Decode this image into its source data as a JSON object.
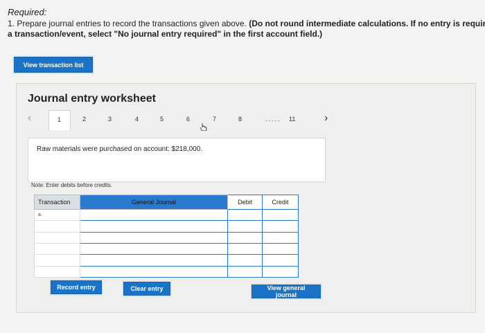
{
  "required": {
    "title": "Required:",
    "line1_normal": "1. Prepare journal entries to record the transactions given above.",
    "line1_bold": "(Do not round intermediate calculations. If no entry is required for",
    "line2": "a transaction/event, select \"No journal entry required\" in the first account field.)"
  },
  "buttons": {
    "view_transaction_list": "View transaction list",
    "record_entry": "Record entry",
    "clear_entry": "Clear entry",
    "view_general_journal": "View general journal"
  },
  "worksheet": {
    "title": "Journal entry worksheet",
    "pages": [
      "1",
      "2",
      "3",
      "4",
      "5",
      "6",
      "7",
      "8",
      "11"
    ],
    "dots": ".....",
    "active_page": "1",
    "description": "Raw materials were purchased on account: $218,000.",
    "note": "Note: Enter debits before credits."
  },
  "table": {
    "headers": {
      "transaction": "Transaction",
      "general_journal": "General Journal",
      "debit": "Debit",
      "credit": "Credit"
    },
    "rows": [
      {
        "transaction": "a.",
        "account": "",
        "debit": "",
        "credit": ""
      },
      {
        "transaction": "",
        "account": "",
        "debit": "",
        "credit": ""
      },
      {
        "transaction": "",
        "account": "",
        "debit": "",
        "credit": ""
      },
      {
        "transaction": "",
        "account": "",
        "debit": "",
        "credit": ""
      },
      {
        "transaction": "",
        "account": "",
        "debit": "",
        "credit": ""
      },
      {
        "transaction": "",
        "account": "",
        "debit": "",
        "credit": ""
      }
    ]
  },
  "colors": {
    "accent": "#1a73c6",
    "table_blue": "#2a7bd0"
  }
}
